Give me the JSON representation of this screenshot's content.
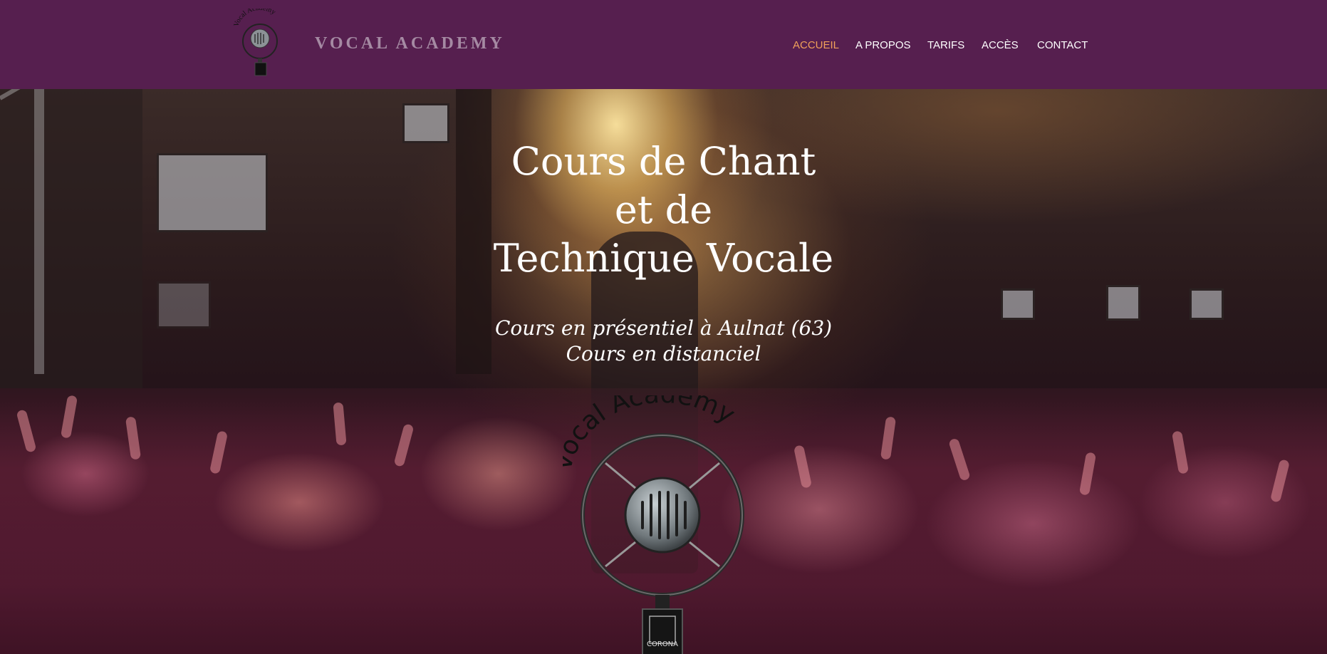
{
  "header": {
    "brand": "VOCAL ACADEMY",
    "logo_small_text": "Vocal Academy",
    "nav": [
      {
        "label": "ACCUEIL",
        "active": true
      },
      {
        "label": "A PROPOS",
        "active": false
      },
      {
        "label": "TARIFS",
        "active": false
      },
      {
        "label": "ACCÈS",
        "active": false
      },
      {
        "label": "CONTACT",
        "active": false
      }
    ]
  },
  "hero": {
    "title_lines": [
      "Cours de Chant",
      "et de",
      "Technique Vocale"
    ],
    "subtitle_lines": [
      "Cours en présentiel à Aulnat (63)",
      "Cours en distanciel"
    ],
    "logo_text": "Vocal Academy",
    "logo_badge": "CORONA"
  },
  "colors": {
    "header_bg": "#561f4f",
    "nav_active": "#f0a05a",
    "brand_text": "#a58aa3"
  }
}
